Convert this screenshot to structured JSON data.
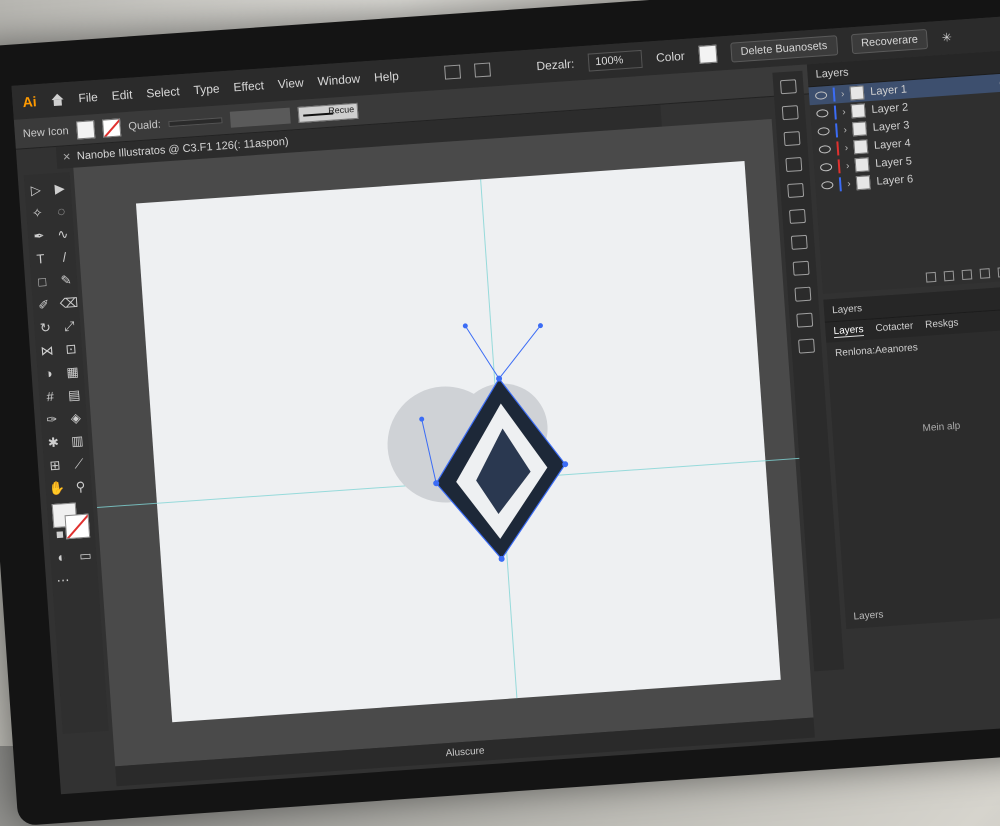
{
  "app": {
    "logo": "Ai"
  },
  "menu": [
    "File",
    "Edit",
    "Select",
    "Type",
    "Effect",
    "View",
    "Window",
    "Help"
  ],
  "buttons": {
    "delete": "Delete Buanosets",
    "recover": "Recoverare"
  },
  "control": {
    "label": "New Icon",
    "opacity_label": "Quald:",
    "stroke_label": "Recue",
    "dezelr_label": "Dezalr:",
    "dezelr_value": "100%",
    "color_label": "Color"
  },
  "document_tab": {
    "title": "Nanobe Illustratos @ C3.F1 126(: 11aspon)"
  },
  "layers_panel": {
    "title": "Layers",
    "rows": [
      {
        "name": "Layer 1",
        "color": "#3b6cf5",
        "selected": true
      },
      {
        "name": "Layer 2",
        "color": "#3b6cf5",
        "selected": false
      },
      {
        "name": "Layer 3",
        "color": "#3b6cf5",
        "selected": false
      },
      {
        "name": "Layer 4",
        "color": "#e0312f",
        "selected": false
      },
      {
        "name": "Layer 5",
        "color": "#e0312f",
        "selected": false
      },
      {
        "name": "Layer 6",
        "color": "#3b6cf5",
        "selected": false
      }
    ]
  },
  "lower_panel": {
    "title": "Layers",
    "tabs": [
      "Layers",
      "Cotacter",
      "Reskgs"
    ],
    "sub_head": "Renlona:Aeanores",
    "center_text": "Mein alp",
    "footer": "Layers"
  },
  "status": {
    "text": "Aluscure"
  },
  "colors": {
    "accent": "#3b6cf5",
    "guide": "#7fd4d4",
    "brand": "#ff9a00"
  }
}
